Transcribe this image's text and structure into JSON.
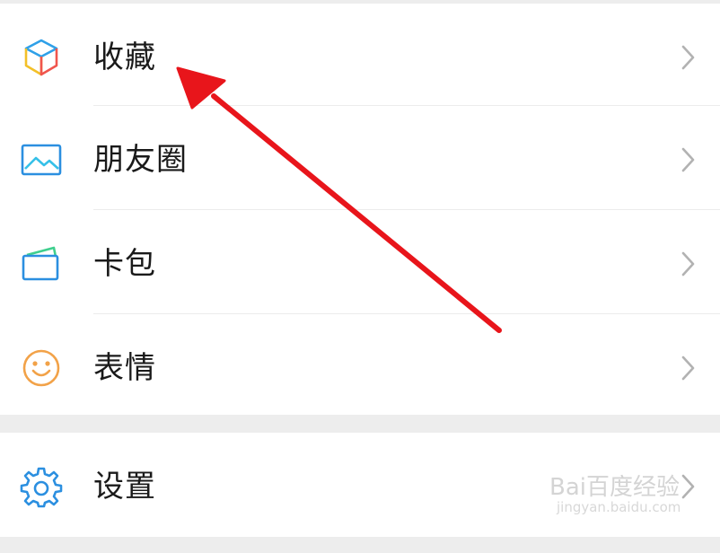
{
  "menu": {
    "items": [
      {
        "label": "收藏",
        "icon": "cube-icon"
      },
      {
        "label": "朋友圈",
        "icon": "photo-icon"
      },
      {
        "label": "卡包",
        "icon": "card-wallet-icon"
      },
      {
        "label": "表情",
        "icon": "smiley-icon"
      }
    ],
    "settings": {
      "label": "设置",
      "icon": "gear-icon"
    }
  },
  "annotation": {
    "color": "#e8151b"
  },
  "watermark": {
    "brand": "Bai百度经验",
    "url": "jingyan.baidu.com"
  },
  "colors": {
    "background": "#ededed",
    "row": "#ffffff",
    "text": "#1a1a1a",
    "chevron": "#b2b2b2"
  }
}
